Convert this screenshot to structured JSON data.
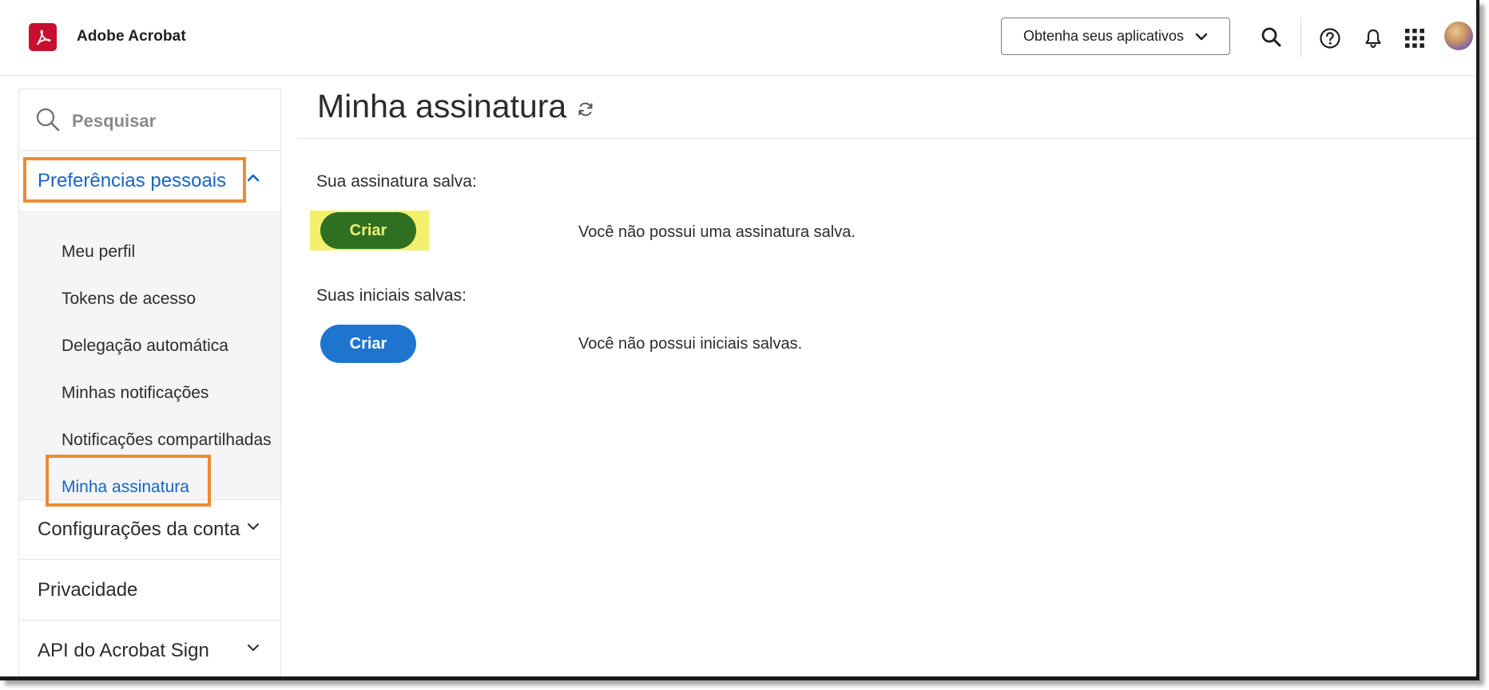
{
  "header": {
    "app_title": "Adobe Acrobat",
    "get_apps_label": "Obtenha seus aplicativos",
    "icons": [
      "search-icon",
      "help-icon",
      "bell-icon",
      "app-grid-icon"
    ]
  },
  "sidebar": {
    "search_placeholder": "Pesquisar",
    "personal_label": "Preferências pessoais",
    "personal_items": [
      "Meu perfil",
      "Tokens de acesso",
      "Delegação automática",
      "Minhas notificações",
      "Notificações compartilhadas",
      "Minha assinatura"
    ],
    "account_label": "Configurações da conta",
    "privacy_label": "Privacidade",
    "api_label": "API do Acrobat Sign"
  },
  "main": {
    "title": "Minha assinatura",
    "signature_label": "Sua assinatura salva:",
    "signature_button": "Criar",
    "signature_message": "Você não possui uma assinatura salva.",
    "initials_label": "Suas iniciais salvas:",
    "initials_button": "Criar",
    "initials_message": "Você não possui iniciais salvas."
  },
  "colors": {
    "accent_blue": "#1565c0",
    "brand_red": "#c8102e",
    "highlight_orange": "#f08a2e",
    "highlight_yellow": "#f3f06e",
    "signature_button": "#2f6f22",
    "initials_button": "#1f74d0"
  }
}
